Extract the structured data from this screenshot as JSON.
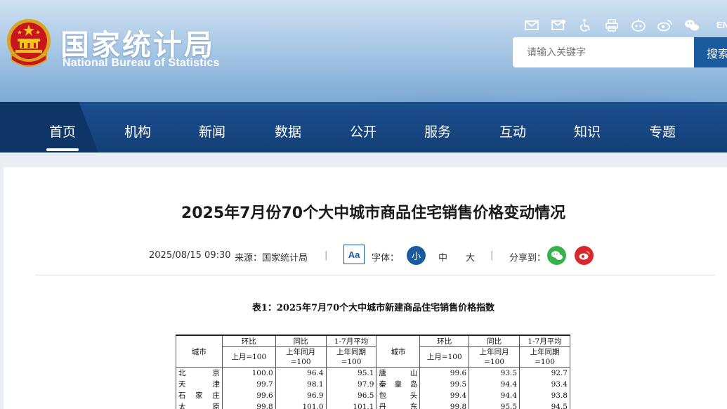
{
  "header": {
    "site_title_cn": "国家统计局",
    "site_title_en": "National Bureau of Statistics",
    "icons": [
      "mail-icon",
      "mail-settings-icon",
      "accessibility-icon",
      "print-icon",
      "robot-icon",
      "weibo-icon",
      "wechat-icon"
    ],
    "lang": "EN",
    "search_placeholder": "请输入关键字",
    "search_button": "搜索"
  },
  "nav": {
    "items": [
      "首页",
      "机构",
      "新闻",
      "数据",
      "公开",
      "服务",
      "互动",
      "知识",
      "专题"
    ],
    "active": "首页"
  },
  "article": {
    "title": "2025年7月份70个大中城市商品住宅销售价格变动情况",
    "date": "2025/08/15 09:30",
    "source": "来源：国家统计局",
    "sep": "|",
    "font_label": "字体：",
    "font_small": "小",
    "font_medium": "中",
    "font_large": "大",
    "share_label": "分享到：",
    "aa": "Aa"
  },
  "table": {
    "caption": "表1：2025年7月70个大中城市新建商品住宅销售价格指数",
    "headers": {
      "city": "城市",
      "mom": "环比",
      "mom_base": "上月=100",
      "yoy": "同比",
      "yoy_base1": "上年同月",
      "yoy_base2": "=100",
      "avg": "1-7月平均",
      "avg_base1": "上年同期",
      "avg_base2": "=100"
    },
    "rows": [
      {
        "c1": "北京",
        "m1": "100.0",
        "y1": "96.4",
        "a1": "95.1",
        "c2": "唐山",
        "m2": "99.6",
        "y2": "93.5",
        "a2": "92.7"
      },
      {
        "c1": "天津",
        "m1": "99.7",
        "y1": "98.1",
        "a1": "97.9",
        "c2": "秦皇岛",
        "m2": "99.5",
        "y2": "94.4",
        "a2": "93.4"
      },
      {
        "c1": "石家庄",
        "m1": "99.6",
        "y1": "96.9",
        "a1": "96.5",
        "c2": "包头",
        "m2": "99.4",
        "y2": "94.4",
        "a2": "93.8"
      },
      {
        "c1": "太原",
        "m1": "99.8",
        "y1": "101.0",
        "a1": "101.1",
        "c2": "丹东",
        "m2": "99.8",
        "y2": "95.5",
        "a2": "94.5"
      }
    ]
  }
}
